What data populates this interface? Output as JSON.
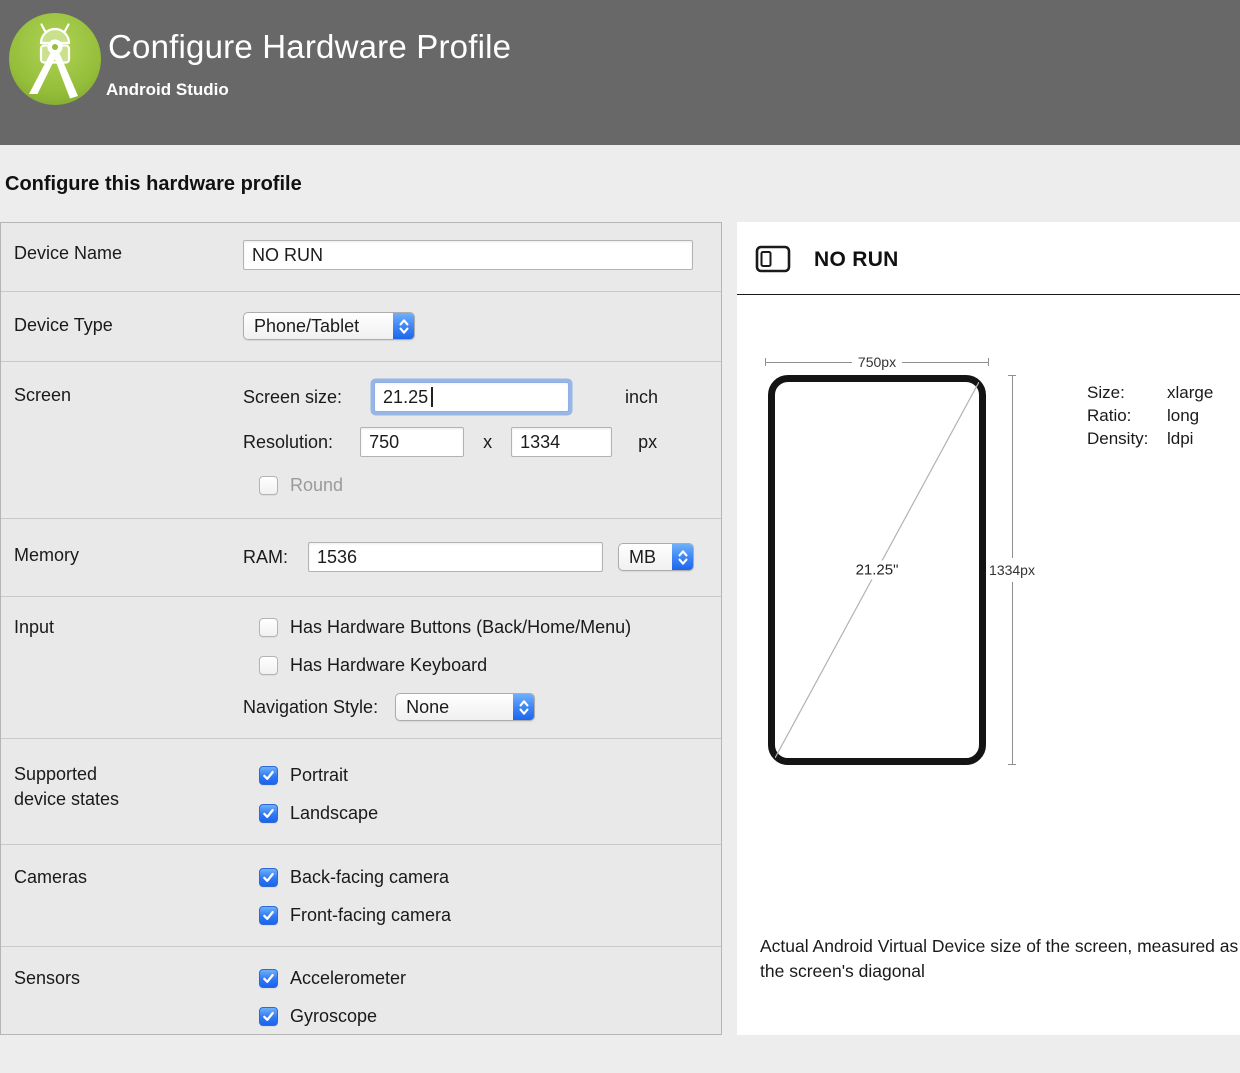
{
  "window": {
    "title": "Configure Hardware Profile",
    "subtitle": "Android Studio"
  },
  "heading": "Configure this hardware profile",
  "form": {
    "device_name": {
      "label": "Device Name",
      "value": "NO RUN"
    },
    "device_type": {
      "label": "Device Type",
      "value": "Phone/Tablet"
    },
    "screen": {
      "label": "Screen",
      "size_label": "Screen size:",
      "size_value": "21.25",
      "size_unit": "inch",
      "resolution_label": "Resolution:",
      "resolution_width": "750",
      "resolution_separator": "x",
      "resolution_height": "1334",
      "resolution_unit": "px",
      "round": {
        "label": "Round",
        "checked": false
      }
    },
    "memory": {
      "label": "Memory",
      "ram_label": "RAM:",
      "ram_value": "1536",
      "ram_unit": "MB"
    },
    "input": {
      "label": "Input",
      "hardware_buttons": {
        "label": "Has Hardware Buttons (Back/Home/Menu)",
        "checked": false
      },
      "hardware_keyboard": {
        "label": "Has Hardware Keyboard",
        "checked": false
      },
      "navigation_style_label": "Navigation Style:",
      "navigation_style_value": "None"
    },
    "device_states": {
      "label": "Supported\ndevice states",
      "portrait": {
        "label": "Portrait",
        "checked": true
      },
      "landscape": {
        "label": "Landscape",
        "checked": true
      }
    },
    "cameras": {
      "label": "Cameras",
      "back": {
        "label": "Back-facing camera",
        "checked": true
      },
      "front": {
        "label": "Front-facing camera",
        "checked": true
      }
    },
    "sensors": {
      "label": "Sensors",
      "accelerometer": {
        "label": "Accelerometer",
        "checked": true
      },
      "gyroscope": {
        "label": "Gyroscope",
        "checked": true
      }
    }
  },
  "preview": {
    "title": "NO RUN",
    "width_label": "750px",
    "height_label": "1334px",
    "diagonal_label": "21.25\"",
    "info": {
      "size_label": "Size:",
      "size_value": "xlarge",
      "ratio_label": "Ratio:",
      "ratio_value": "long",
      "density_label": "Density:",
      "density_value": "ldpi"
    },
    "note": "Actual Android Virtual Device size of the screen, measured as the screen's diagonal"
  }
}
